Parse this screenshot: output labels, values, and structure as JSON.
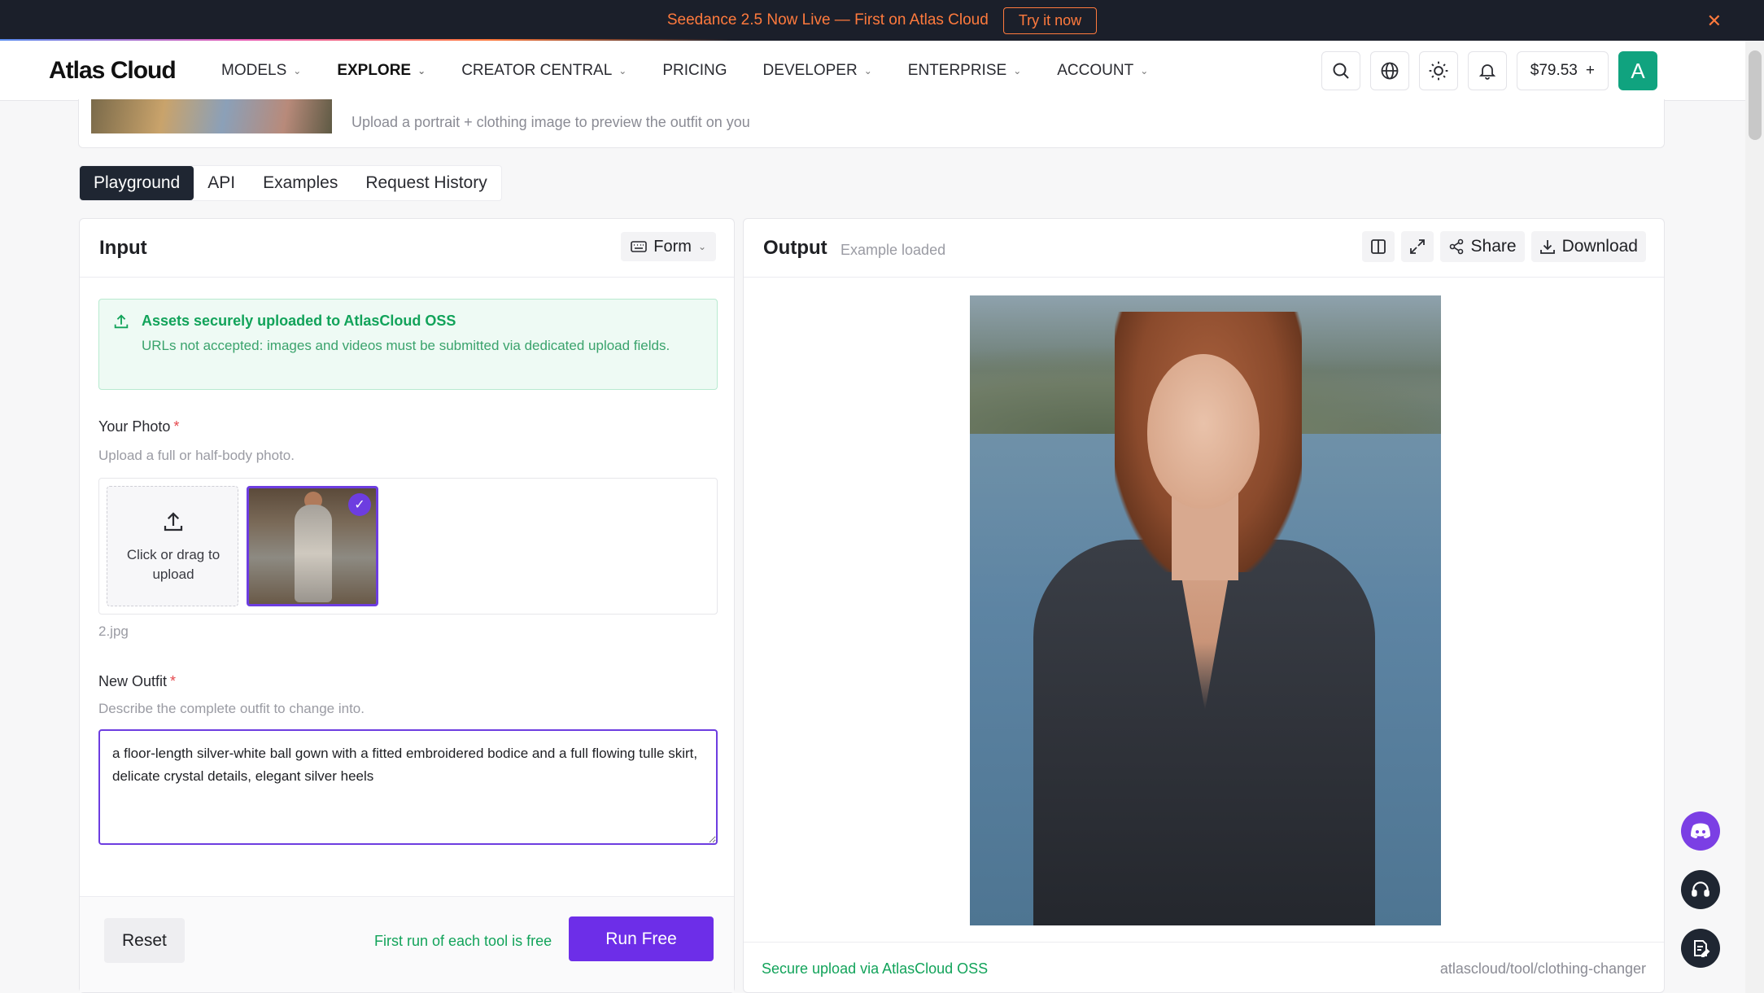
{
  "announcement": {
    "text": "Seedance 2.5 Now Live — First on Atlas Cloud",
    "cta": "Try it now",
    "close_icon": "close-icon"
  },
  "nav": {
    "logo": "Atlas Cloud",
    "items": [
      {
        "label": "MODELS",
        "dropdown": true
      },
      {
        "label": "EXPLORE",
        "dropdown": true
      },
      {
        "label": "CREATOR CENTRAL",
        "dropdown": true
      },
      {
        "label": "PRICING",
        "dropdown": false
      },
      {
        "label": "DEVELOPER",
        "dropdown": true
      },
      {
        "label": "ENTERPRISE",
        "dropdown": true
      },
      {
        "label": "ACCOUNT",
        "dropdown": true
      }
    ],
    "balance": "$79.53",
    "balance_add": "+",
    "avatar_initial": "A"
  },
  "hero": {
    "subtitle": "Upload a portrait + clothing image to preview the outfit on you"
  },
  "tabs": [
    {
      "label": "Playground",
      "active": true
    },
    {
      "label": "API",
      "active": false
    },
    {
      "label": "Examples",
      "active": false
    },
    {
      "label": "Request History",
      "active": false
    }
  ],
  "input": {
    "title": "Input",
    "mode_label": "Form",
    "notice": {
      "title": "Assets securely uploaded to AtlasCloud OSS",
      "body": "URLs not accepted: images and videos must be submitted via dedicated upload fields."
    },
    "photo": {
      "label": "Your Photo",
      "required_mark": "*",
      "help": "Upload a full or half-body photo.",
      "upload_text": "Click or drag to upload",
      "filename": "2.jpg"
    },
    "outfit": {
      "label": "New Outfit",
      "required_mark": "*",
      "help": "Describe the complete outfit to change into.",
      "value": "a floor-length silver-white ball gown with a fitted embroidered bodice and a full flowing tulle skirt, delicate crystal details, elegant silver heels"
    },
    "reset_label": "Reset",
    "free_note": "First run of each tool is free",
    "run_label": "Run Free"
  },
  "output": {
    "title": "Output",
    "status": "Example loaded",
    "share_label": "Share",
    "download_label": "Download",
    "secure_note": "Secure upload via AtlasCloud OSS",
    "tool_path": "atlascloud/tool/clothing-changer"
  },
  "colors": {
    "accent": "#6d2ee8",
    "success": "#12a35a",
    "announce_bg": "#1b1f2a",
    "announce_fg": "#ff7a3d"
  }
}
